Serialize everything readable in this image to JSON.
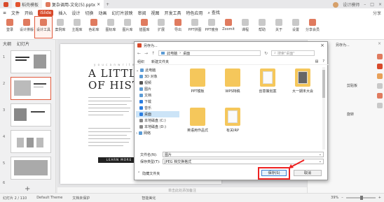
{
  "tabs": [
    {
      "label": "稻壳模板"
    },
    {
      "label": "复杂调用-文化(5).pptx"
    }
  ],
  "topright": {
    "user": "设计模师"
  },
  "menu": {
    "file": "文件",
    "items": [
      "开始",
      "插入",
      "设计",
      "切换",
      "动画",
      "幻灯片放映",
      "审阅",
      "视图",
      "开发工具",
      "特色应用"
    ],
    "highlighted": "iSlide",
    "search": "查找",
    "share": "分享"
  },
  "ribbon": [
    {
      "label": "登录"
    },
    {
      "label": "设计排版"
    },
    {
      "label": "设计工具"
    },
    {
      "label": "案例库"
    },
    {
      "label": "主题库"
    },
    {
      "label": "色彩库"
    },
    {
      "label": "图标库"
    },
    {
      "label": "图片库"
    },
    {
      "label": "插图库"
    },
    {
      "label": "扩展"
    },
    {
      "label": "导出"
    },
    {
      "label": "PPT拼图"
    },
    {
      "label": "PPT瘦身"
    },
    {
      "label": "Zoomit"
    },
    {
      "label": "课程"
    },
    {
      "label": "帮助"
    },
    {
      "label": "关于"
    },
    {
      "label": "设置"
    },
    {
      "label": "分享会员"
    }
  ],
  "leftpanel": {
    "tab1": "大纲",
    "tab2": "幻灯片",
    "slide_numbers": [
      "1",
      "2",
      "3",
      "4",
      "5",
      "6"
    ]
  },
  "slide": {
    "small": "y o u   c a n   w r i t e",
    "title_line1": "A LITTLE",
    "title_line2": "OF HISTO",
    "button": "LEARN MORE"
  },
  "notes": "单击此处添加备注",
  "dialog": {
    "title": "另存为...",
    "path": [
      "此电脑",
      "桌面"
    ],
    "search_placeholder": "搜索\"桌面\"",
    "organize": "组织",
    "new_folder": "新建文件夹",
    "tree": [
      {
        "label": "此电脑",
        "color": "#5b9bd5"
      },
      {
        "label": "3D 对象",
        "color": "#5b9bd5"
      },
      {
        "label": "视频",
        "color": "#555555"
      },
      {
        "label": "图片",
        "color": "#5b9bd5"
      },
      {
        "label": "文档",
        "color": "#5b9bd5"
      },
      {
        "label": "下载",
        "color": "#2b7de0"
      },
      {
        "label": "音乐",
        "color": "#2b7de0"
      },
      {
        "label": "桌面",
        "color": "#2b7de0"
      },
      {
        "label": "本地磁盘 (C:)",
        "color": "#888888"
      },
      {
        "label": "本地磁盘 (D:)",
        "color": "#888888"
      },
      {
        "label": "网络",
        "color": "#5b9bd5"
      }
    ],
    "files": [
      {
        "label": "PPT模板"
      },
      {
        "label": "WPS特稿"
      },
      {
        "label": "创意策划案"
      },
      {
        "label": "大一期末大会"
      },
      {
        "label": "英语用作品式"
      },
      {
        "label": "有关IRP"
      }
    ],
    "filename_label": "文件名(N):",
    "filename_value": "图片",
    "filetype_label": "保存类型(T):",
    "filetype_value": "JPEG 档交换格式",
    "hide_folders": "隐藏文件夹",
    "save_button": "保存(S)",
    "cancel_button": "取消"
  },
  "rightpanel": {
    "title": "另存为...",
    "items": [
      "剪贴板",
      "旋转"
    ]
  },
  "status": {
    "slide": "幻灯片 2 / 110",
    "theme": "Default Theme",
    "doc": "文档未保护",
    "beautify": "智能美化",
    "zoom": "39%"
  },
  "colors": {
    "accent": "#d84a2b",
    "highlight_red": "#e22222",
    "dialog_blue": "#3c7fd1"
  }
}
